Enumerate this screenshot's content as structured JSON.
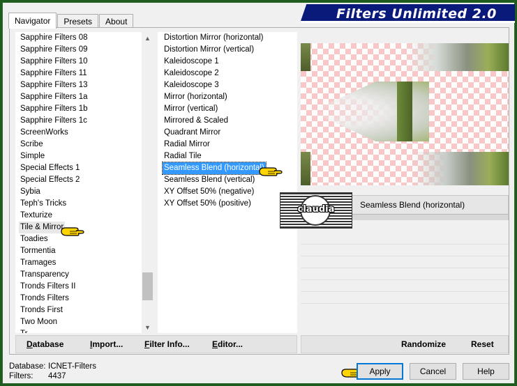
{
  "window": {
    "title": "Filters Unlimited 2.0"
  },
  "tabs": [
    {
      "label": "Navigator",
      "active": true
    },
    {
      "label": "Presets",
      "active": false
    },
    {
      "label": "About",
      "active": false
    }
  ],
  "categories": {
    "items": [
      "Sapphire Filters 08",
      "Sapphire Filters 09",
      "Sapphire Filters 10",
      "Sapphire Filters 11",
      "Sapphire Filters 13",
      "Sapphire Filters 1a",
      "Sapphire Filters 1b",
      "Sapphire Filters 1c",
      "ScreenWorks",
      "Scribe",
      "Simple",
      "Special Effects 1",
      "Special Effects 2",
      "Sybia",
      "Teph's Tricks",
      "Texturize",
      "Tile & Mirror",
      "Toadies",
      "Tormentia",
      "Tramages",
      "Transparency",
      "Tronds Filters II",
      "Tronds Filters",
      "Tronds First",
      "Two Moon",
      "Tr"
    ],
    "selected": "Tile & Mirror"
  },
  "filters": {
    "items": [
      "Distortion Mirror (horizontal)",
      "Distortion Mirror (vertical)",
      "Kaleidoscope 1",
      "Kaleidoscope 2",
      "Kaleidoscope 3",
      "Mirror (horizontal)",
      "Mirror (vertical)",
      "Mirrored & Scaled",
      "Quadrant Mirror",
      "Radial Mirror",
      "Radial Tile",
      "Seamless Blend (horizontal)",
      "Seamless Blend (vertical)",
      "XY Offset 50% (negative)",
      "XY Offset 50% (positive)"
    ],
    "selected": "Seamless Blend (horizontal)"
  },
  "preview": {
    "filter_name": "Seamless Blend (horizontal)"
  },
  "watermark": {
    "text": "claudia"
  },
  "toolbar_left": {
    "database": "Database",
    "import": "Import...",
    "filter_info": "Filter Info...",
    "editor": "Editor..."
  },
  "toolbar_right": {
    "randomize": "Randomize",
    "reset": "Reset"
  },
  "footer": {
    "database_label": "Database:",
    "database_value": "ICNET-Filters",
    "filters_label": "Filters:",
    "filters_value": "4437"
  },
  "buttons": {
    "apply": "Apply",
    "cancel": "Cancel",
    "help": "Help"
  },
  "colors": {
    "banner": "#0a1a7a",
    "selection": "#3399ff",
    "outer_border": "#1f5a1f",
    "pointer_hand": "#ffd400"
  }
}
